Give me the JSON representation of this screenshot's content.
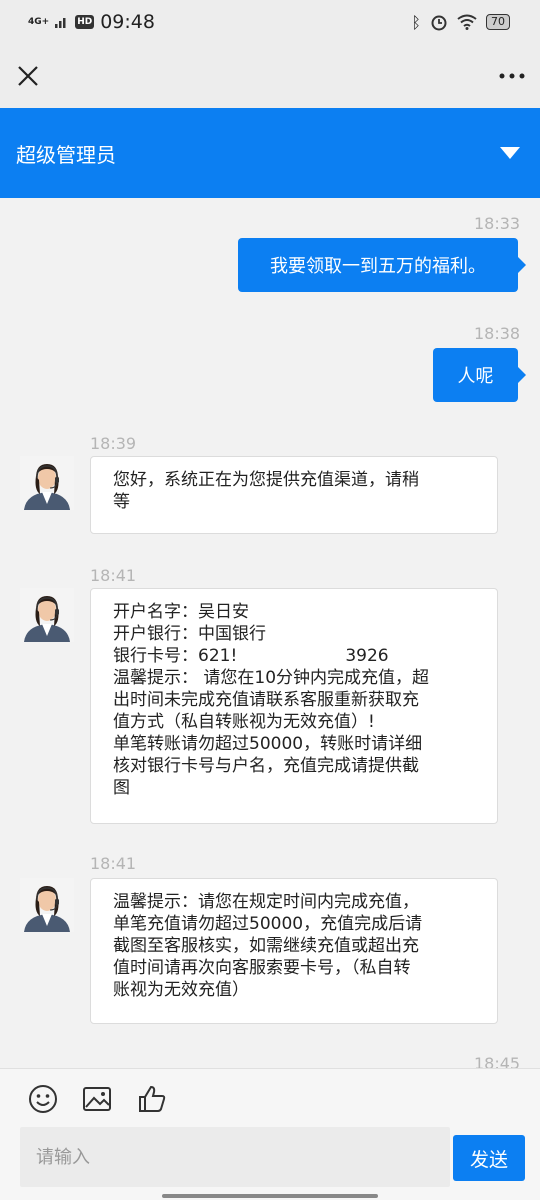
{
  "status_bar": {
    "network": "4G+",
    "hd": "HD",
    "time": "09:48",
    "icons": [
      "bluetooth-icon",
      "alarm-icon",
      "wifi-icon",
      "battery-icon"
    ],
    "battery": "70"
  },
  "nav": {
    "close_icon": "close-icon",
    "more_icon": "more-icon"
  },
  "header": {
    "title": "超级管理员",
    "dropdown_icon": "chevron-down-icon",
    "color": "#0c7ff2"
  },
  "messages": [
    {
      "time": "18:33",
      "from": "me",
      "text": "我要领取一到五万的福利。"
    },
    {
      "time": "18:38",
      "from": "me",
      "text": "人呢"
    },
    {
      "time": "18:39",
      "from": "agent",
      "text": "您好，系统正在为您提供充值渠道，请稍\n等"
    },
    {
      "time": "18:41",
      "from": "agent",
      "text": "开户名字：吴日安\n开户银行：中国银行\n银行卡号：621!                    3926\n温馨提示： 请您在10分钟内完成充值，超\n出时间未完成充值请联系客服重新获取充\n值方式（私自转账视为无效充值）!\n单笔转账请勿超过50000，转账时请详细\n核对银行卡号与户名，充值完成请提供截\n图"
    },
    {
      "time": "18:41",
      "from": "agent",
      "text": "温馨提示：请您在规定时间内完成充值，\n单笔充值请勿超过50000，充值完成后请\n截图至客服核实，如需继续充值或超出充\n值时间请再次向客服索要卡号，（私自转\n账视为无效充值）"
    },
    {
      "time": "18:45",
      "from": "agent",
      "text": ""
    }
  ],
  "toolbar": {
    "icons": [
      "emoji-icon",
      "image-icon",
      "thumbs-up-icon"
    ],
    "input_placeholder": "请输入",
    "send_label": "发送"
  }
}
